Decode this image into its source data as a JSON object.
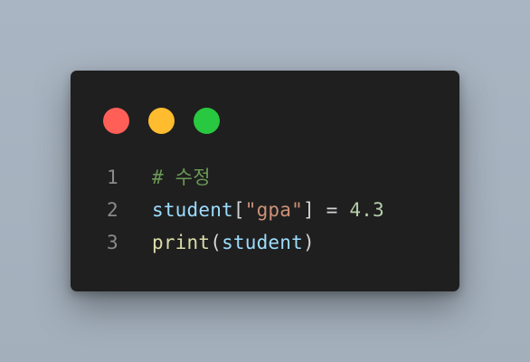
{
  "window": {
    "controls": {
      "close_color": "#ff5f57",
      "minimize_color": "#febc2e",
      "maximize_color": "#28c840"
    }
  },
  "code": {
    "lines": [
      {
        "number": "1",
        "tokens": [
          {
            "text": "# 수정",
            "kind": "comment"
          }
        ]
      },
      {
        "number": "2",
        "tokens": [
          {
            "text": "student",
            "kind": "variable"
          },
          {
            "text": "[",
            "kind": "punctuation"
          },
          {
            "text": "\"gpa\"",
            "kind": "string"
          },
          {
            "text": "]",
            "kind": "punctuation"
          },
          {
            "text": " = ",
            "kind": "punctuation"
          },
          {
            "text": "4.3",
            "kind": "number"
          }
        ]
      },
      {
        "number": "3",
        "tokens": [
          {
            "text": "print",
            "kind": "function"
          },
          {
            "text": "(",
            "kind": "punctuation"
          },
          {
            "text": "student",
            "kind": "variable"
          },
          {
            "text": ")",
            "kind": "punctuation"
          }
        ]
      }
    ]
  }
}
